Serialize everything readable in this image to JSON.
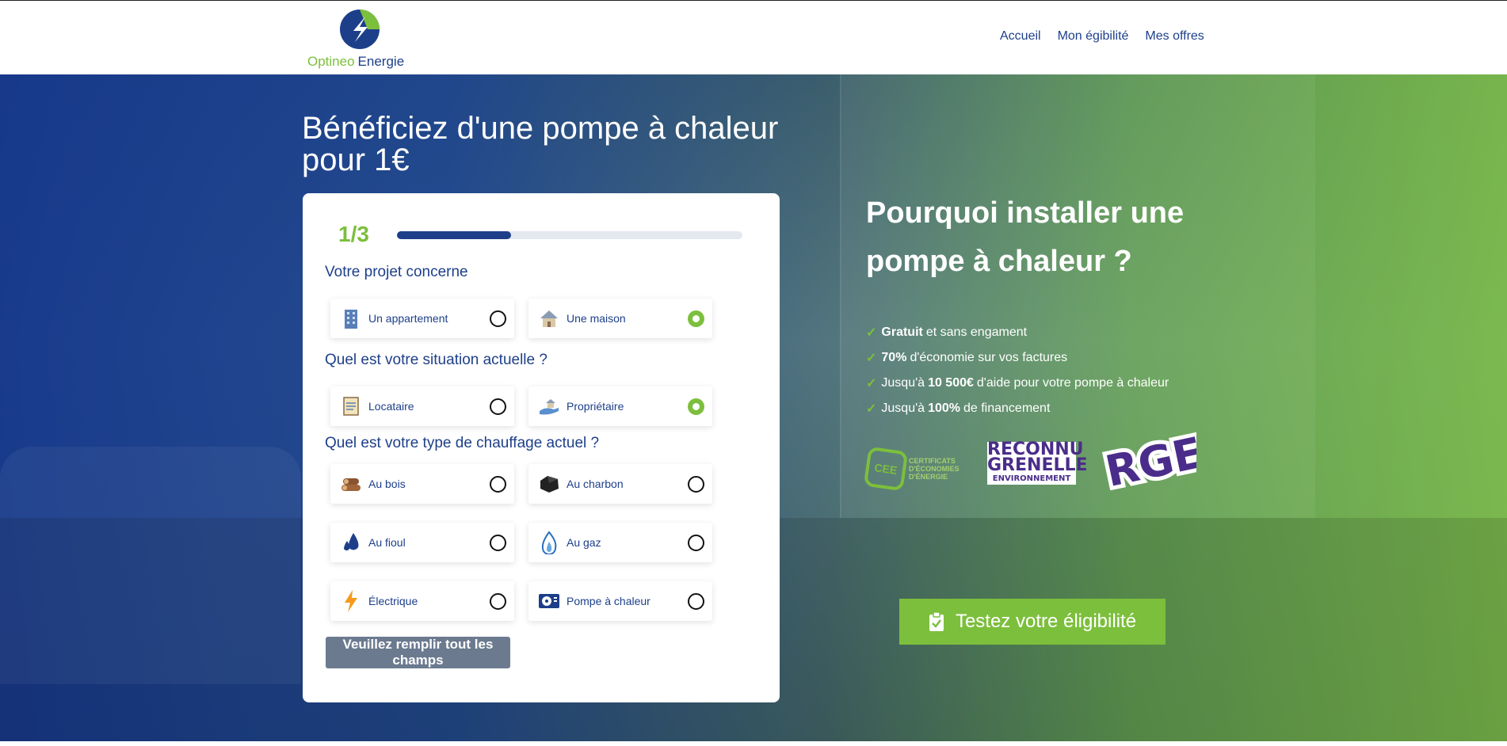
{
  "header": {
    "logo_word1": "Optineo",
    "logo_word2": "Energie",
    "nav": [
      "Accueil",
      "Mon égibilité",
      "Mes offres"
    ]
  },
  "hero": {
    "title": "Bénéficiez d'une pompe à chaleur pour 1€"
  },
  "form": {
    "step": "1/3",
    "progress_fraction": 0.33,
    "q1": {
      "label": "Votre projet concerne",
      "options": [
        {
          "label": "Un appartement",
          "icon": "apartment-building-icon",
          "selected": false
        },
        {
          "label": "Une maison",
          "icon": "house-icon",
          "selected": true
        }
      ]
    },
    "q2": {
      "label": "Quel est votre situation actuelle ?",
      "options": [
        {
          "label": "Locataire",
          "icon": "lease-document-icon",
          "selected": false
        },
        {
          "label": "Propriétaire",
          "icon": "hand-house-icon",
          "selected": true
        }
      ]
    },
    "q3": {
      "label": "Quel est votre type de chauffage actuel ?",
      "options": [
        {
          "label": "Au bois",
          "icon": "wood-logs-icon",
          "selected": false
        },
        {
          "label": "Au charbon",
          "icon": "coal-icon",
          "selected": false
        },
        {
          "label": "Au fioul",
          "icon": "oil-drop-icon",
          "selected": false
        },
        {
          "label": "Au gaz",
          "icon": "gas-flame-icon",
          "selected": false
        },
        {
          "label": "Électrique",
          "icon": "lightning-icon",
          "selected": false
        },
        {
          "label": "Pompe à chaleur",
          "icon": "heat-pump-icon",
          "selected": false
        }
      ]
    },
    "submit_label": "Veuillez remplir tout les champs"
  },
  "why": {
    "title": "Pourquoi installer une pompe à chaleur ?",
    "benefits": [
      {
        "pre": "",
        "bold": "Gratuit",
        "post": "et sans engament"
      },
      {
        "pre": "",
        "bold": "70%",
        "post": "d'économie sur vos factures"
      },
      {
        "pre": "Jusqu'à",
        "bold": "10 500€",
        "post": "d'aide pour votre pompe à chaleur"
      },
      {
        "pre": "Jusqu'à",
        "bold": "100%",
        "post": "de financement"
      }
    ],
    "badges": {
      "cee_abbr": "CEE",
      "cee_line1": "CERTIFICATS",
      "cee_line2": "D'ÉCONOMIES",
      "cee_line3": "D'ÉNERGIE",
      "grenelle_line1": "RECONNU",
      "grenelle_line2": "GRENELLE",
      "grenelle_line3": "ENVIRONNEMENT",
      "rge": "RGE"
    },
    "cta_label": "Testez votre éligibilité"
  },
  "colors": {
    "brand_blue": "#1d3f8a",
    "brand_green": "#7cbf3c",
    "submit_disabled": "#6b7a8f"
  }
}
